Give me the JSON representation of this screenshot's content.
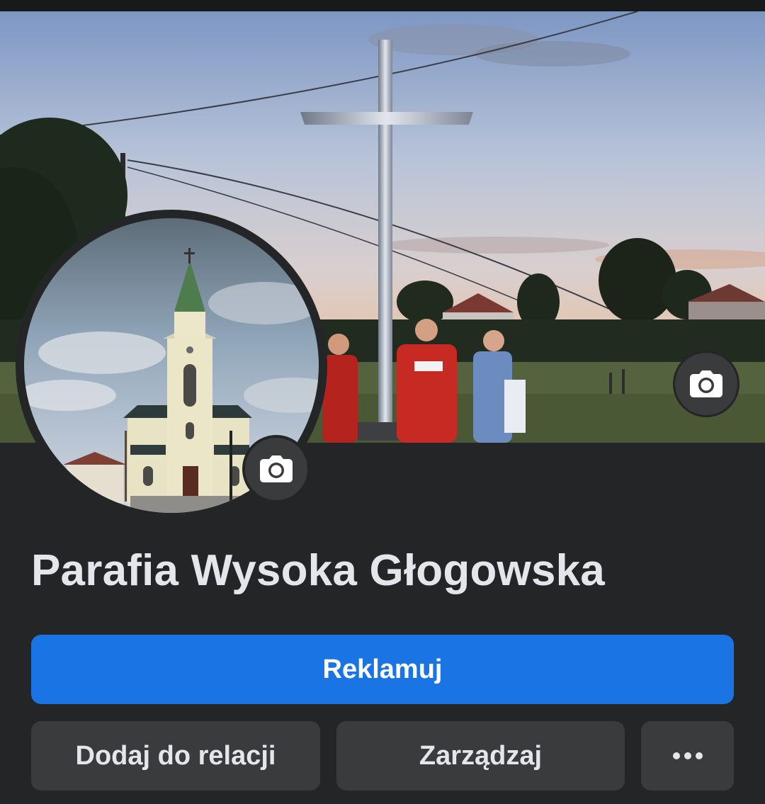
{
  "page": {
    "title": "Parafia Wysoka Głogowska"
  },
  "cover": {
    "camera_icon": "camera-icon"
  },
  "avatar": {
    "camera_icon": "camera-icon"
  },
  "actions": {
    "promote_label": "Reklamuj",
    "add_story_label": "Dodaj do relacji",
    "manage_label": "Zarządzaj",
    "more_icon": "more-dots-icon"
  },
  "colors": {
    "background": "#242526",
    "primary_button": "#1b74e4",
    "secondary_button": "#3a3b3c",
    "text": "#e4e6eb"
  }
}
